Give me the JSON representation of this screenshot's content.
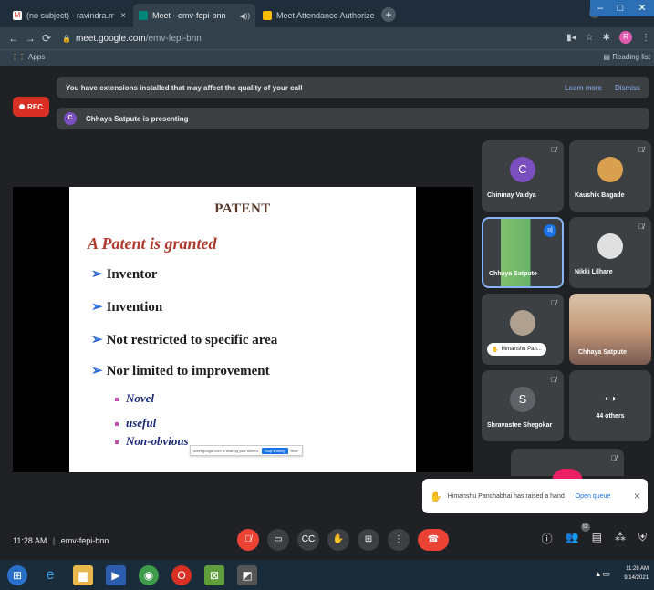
{
  "browser": {
    "tabs": [
      {
        "title": "(no subject) - ravindra.mechanic..."
      },
      {
        "title": "Meet - emv-fepi-bnn"
      },
      {
        "title": "Meet Attendance Authorize"
      }
    ],
    "tab_close": "×",
    "url_host": "meet.google.com",
    "url_path": "/emv-fepi-bnn",
    "apps_label": "Apps",
    "reading_list_label": "Reading list",
    "profile_initial": "R"
  },
  "meet": {
    "rec_label": "REC",
    "extension_notice": "You have extensions installed that may affect the quality of your call",
    "learn_more": "Learn more",
    "dismiss": "Dismiss",
    "presenting_initial": "C",
    "presenting_text": "Chhaya Satpute is presenting",
    "slide": {
      "title": "PATENT",
      "subtitle": "A Patent is granted",
      "bullets": [
        "Inventor",
        "Invention",
        "Not restricted to specific area",
        "Nor limited to improvement"
      ],
      "sub_bullets": [
        "Novel",
        "useful",
        "Non-obvious"
      ],
      "share_bar_text": "meet.google.com is sharing your screen.",
      "share_stop": "Stop sharing",
      "share_hide": "Hide"
    },
    "participants": [
      {
        "name": "Chinmay Vaidya",
        "initial": "C",
        "color": "#7b4fbf"
      },
      {
        "name": "Kaushik Bagade",
        "initial": "",
        "color": "#d9a14f"
      },
      {
        "name": "Chhaya Satpute",
        "initial": "",
        "color": "#6bb36b"
      },
      {
        "name": "Nikki Lilhare",
        "initial": "",
        "color": "#c8c8c8"
      },
      {
        "name": "Himanshu Pan...",
        "initial": "",
        "color": "#b0a090"
      },
      {
        "name": "Chhaya Satpute",
        "initial": "",
        "color": "#a07060"
      },
      {
        "name": "Shravastee Shegokar",
        "initial": "S",
        "color": "#5f6368"
      },
      {
        "name": "44 others",
        "initial": "",
        "color": "#5f6368"
      }
    ],
    "toast": {
      "text": "Himanshu Panchabhai has raised a hand",
      "action": "Open queue",
      "close": "×"
    },
    "time": "11:28 AM",
    "separator": "|",
    "meeting_code": "emv-fepi-bnn",
    "people_count": "53"
  },
  "taskbar": {
    "time": "11:28 AM",
    "date": "9/14/2021"
  }
}
